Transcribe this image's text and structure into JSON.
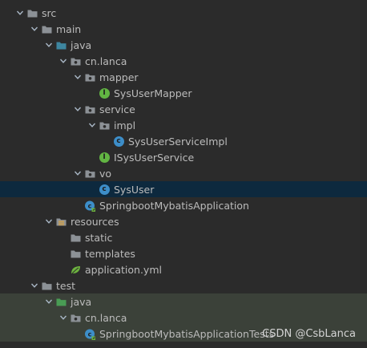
{
  "tree": [
    {
      "label": "src",
      "depth": 1,
      "kind": "folder",
      "expanded": true
    },
    {
      "label": "main",
      "depth": 2,
      "kind": "folder",
      "expanded": true
    },
    {
      "label": "java",
      "depth": 3,
      "kind": "source-folder",
      "expanded": true
    },
    {
      "label": "cn.lanca",
      "depth": 4,
      "kind": "package",
      "expanded": true
    },
    {
      "label": "mapper",
      "depth": 5,
      "kind": "package",
      "expanded": true
    },
    {
      "label": "SysUserMapper",
      "depth": 6,
      "kind": "interface"
    },
    {
      "label": "service",
      "depth": 5,
      "kind": "package",
      "expanded": true
    },
    {
      "label": "impl",
      "depth": 6,
      "kind": "package",
      "expanded": true
    },
    {
      "label": "SysUserServiceImpl",
      "depth": 7,
      "kind": "class"
    },
    {
      "label": "ISysUserService",
      "depth": 6,
      "kind": "interface"
    },
    {
      "label": "vo",
      "depth": 5,
      "kind": "package",
      "expanded": true
    },
    {
      "label": "SysUser",
      "depth": 6,
      "kind": "class",
      "selected": true
    },
    {
      "label": "SpringbootMybatisApplication",
      "depth": 5,
      "kind": "spring-class"
    },
    {
      "label": "resources",
      "depth": 3,
      "kind": "resources-folder",
      "expanded": true
    },
    {
      "label": "static",
      "depth": 4,
      "kind": "folder"
    },
    {
      "label": "templates",
      "depth": 4,
      "kind": "folder"
    },
    {
      "label": "application.yml",
      "depth": 4,
      "kind": "yml"
    },
    {
      "label": "test",
      "depth": 2,
      "kind": "folder",
      "expanded": true
    },
    {
      "label": "java",
      "depth": 3,
      "kind": "test-folder",
      "expanded": true,
      "test": true
    },
    {
      "label": "cn.lanca",
      "depth": 4,
      "kind": "package",
      "expanded": true,
      "test": true
    },
    {
      "label": "SpringbootMybatisApplicationTests",
      "depth": 5,
      "kind": "spring-class",
      "test": true
    }
  ],
  "icon_names": {
    "folder": "folder-icon",
    "source-folder": "source-folder-icon",
    "package": "package-icon",
    "interface": "interface-icon",
    "class": "class-icon",
    "spring-class": "spring-boot-class-icon",
    "resources-folder": "resources-folder-icon",
    "yml": "yml-file-icon",
    "test-folder": "test-folder-icon"
  },
  "colors": {
    "background": "#2b2b2b",
    "selected_row": "#0d293e",
    "test_row": "#3b4139",
    "folder": "#8c9196",
    "source_folder": "#3e86a0",
    "test_folder": "#499c54",
    "class": "#3d8ec9",
    "interface": "#62b543",
    "text": "#bbbbbb"
  },
  "watermark": "CSDN @CsbLanca"
}
